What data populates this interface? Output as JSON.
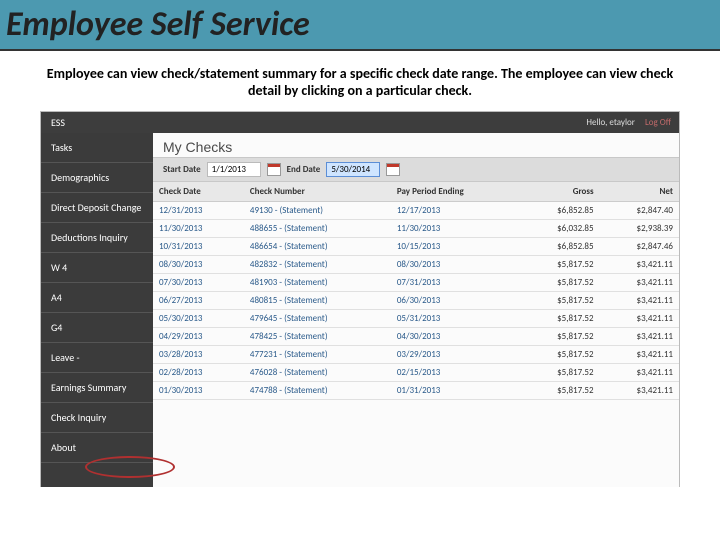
{
  "page": {
    "title": "Employee Self Service",
    "subtitle": "Employee can view check/statement summary for a specific check date range.  The employee  can view check detail by clicking on a particular check."
  },
  "ess": {
    "brand": "ESS",
    "greeting": "Hello, etaylor",
    "logoff": "Log Off"
  },
  "sidebar": {
    "items": [
      {
        "label": "Tasks"
      },
      {
        "label": "Demographics"
      },
      {
        "label": "Direct Deposit Change"
      },
      {
        "label": "Deductions Inquiry"
      },
      {
        "label": "W 4"
      },
      {
        "label": "A4"
      },
      {
        "label": "G4"
      },
      {
        "label": "Leave  -"
      },
      {
        "label": "Earnings Summary"
      },
      {
        "label": "Check Inquiry"
      },
      {
        "label": "About"
      }
    ]
  },
  "main": {
    "heading": "My Checks",
    "start_label": "Start Date",
    "start_value": "1/1/2013",
    "end_label": "End Date",
    "end_value": "5/30/2014"
  },
  "columns": {
    "c0": "Check Date",
    "c1": "Check Number",
    "c2": "Pay Period Ending",
    "c3": "Gross",
    "c4": "Net"
  },
  "rows": [
    {
      "date": "12/31/2013",
      "num": "49130 - (Statement)",
      "ppe": "12/17/2013",
      "gross": "$6,852.85",
      "net": "$2,847.40"
    },
    {
      "date": "11/30/2013",
      "num": "488655 - (Statement)",
      "ppe": "11/30/2013",
      "gross": "$6,032.85",
      "net": "$2,938.39"
    },
    {
      "date": "10/31/2013",
      "num": "486654 - (Statement)",
      "ppe": "10/15/2013",
      "gross": "$6,852.85",
      "net": "$2,847.46"
    },
    {
      "date": "08/30/2013",
      "num": "482832 - (Statement)",
      "ppe": "08/30/2013",
      "gross": "$5,817.52",
      "net": "$3,421.11"
    },
    {
      "date": "07/30/2013",
      "num": "481903 - (Statement)",
      "ppe": "07/31/2013",
      "gross": "$5,817.52",
      "net": "$3,421.11"
    },
    {
      "date": "06/27/2013",
      "num": "480815 - (Statement)",
      "ppe": "06/30/2013",
      "gross": "$5,817.52",
      "net": "$3,421.11"
    },
    {
      "date": "05/30/2013",
      "num": "479645 - (Statement)",
      "ppe": "05/31/2013",
      "gross": "$5,817.52",
      "net": "$3,421.11"
    },
    {
      "date": "04/29/2013",
      "num": "478425 - (Statement)",
      "ppe": "04/30/2013",
      "gross": "$5,817.52",
      "net": "$3,421.11"
    },
    {
      "date": "03/28/2013",
      "num": "477231 - (Statement)",
      "ppe": "03/29/2013",
      "gross": "$5,817.52",
      "net": "$3,421.11"
    },
    {
      "date": "02/28/2013",
      "num": "476028 - (Statement)",
      "ppe": "02/15/2013",
      "gross": "$5,817.52",
      "net": "$3,421.11"
    },
    {
      "date": "01/30/2013",
      "num": "474788 - (Statement)",
      "ppe": "01/31/2013",
      "gross": "$5,817.52",
      "net": "$3,421.11"
    }
  ],
  "highlight": {
    "sidebar_circled": "Check Inquiry"
  }
}
